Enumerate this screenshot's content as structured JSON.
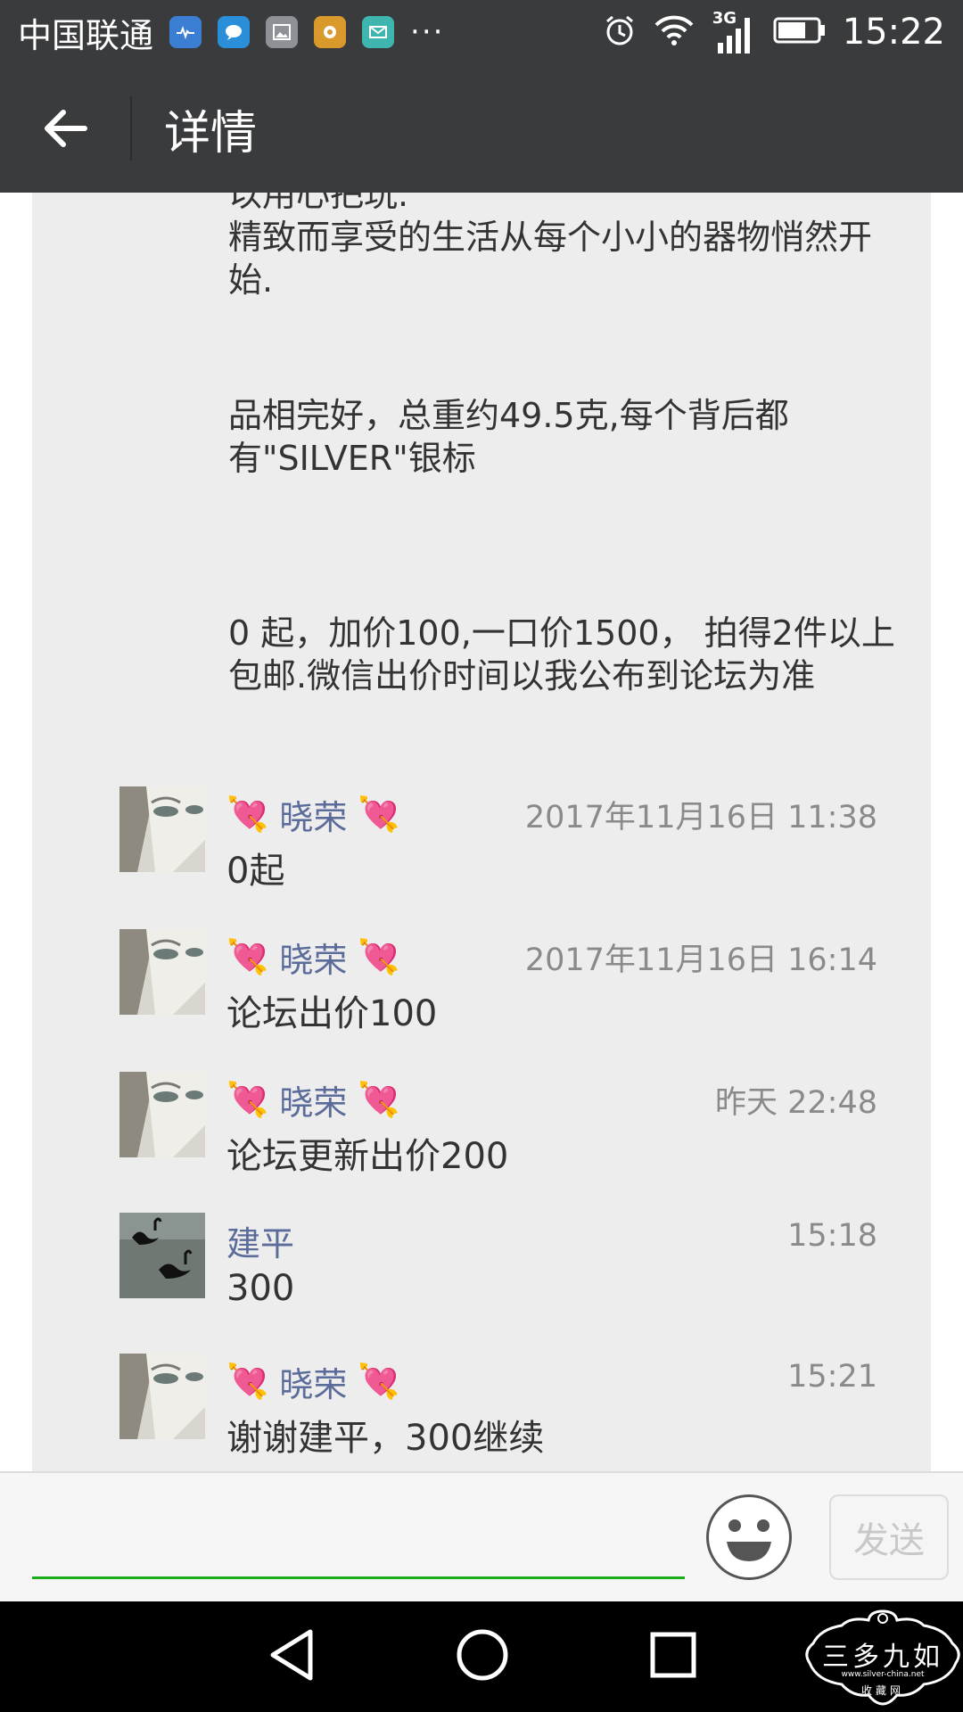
{
  "status_bar": {
    "carrier": "中国联通",
    "more": "···",
    "time": "15:22",
    "network": "3G"
  },
  "app_bar": {
    "title": "详情"
  },
  "post": {
    "lines": [
      "以用心把玩.",
      "精致而享受的生活从每个小小的器物悄然开始.",
      "品相完好，总重约49.5克,每个背后都有\"SILVER\"银标",
      "0 起，加价100,一口价1500， 拍得2件以上包邮.微信出价时间以我公布到论坛为准"
    ]
  },
  "comments": [
    {
      "name": "晓荣",
      "heart": "💘",
      "time": "2017年11月16日 11:38",
      "text": "0起",
      "avatar": "portrait"
    },
    {
      "name": "晓荣",
      "heart": "💘",
      "time": "2017年11月16日 16:14",
      "text": "论坛出价100",
      "avatar": "portrait"
    },
    {
      "name": "晓荣",
      "heart": "💘",
      "time": "昨天 22:48",
      "text": "论坛更新出价200",
      "avatar": "portrait"
    },
    {
      "name": "建平",
      "heart": "",
      "time": "15:18",
      "text": "300",
      "avatar": "swans"
    },
    {
      "name": "晓荣",
      "heart": "💘",
      "time": "15:21",
      "text": "谢谢建平，300继续",
      "avatar": "portrait"
    }
  ],
  "input_bar": {
    "input_value": "",
    "send_label": "发送"
  },
  "watermark": {
    "text": "三多九如",
    "url": "www.silver-china.net",
    "sub": "收藏网"
  },
  "colors": {
    "accent_green": "#1aad19",
    "name_blue": "#5b6b9a",
    "bar_dark": "#3a3b3d"
  }
}
